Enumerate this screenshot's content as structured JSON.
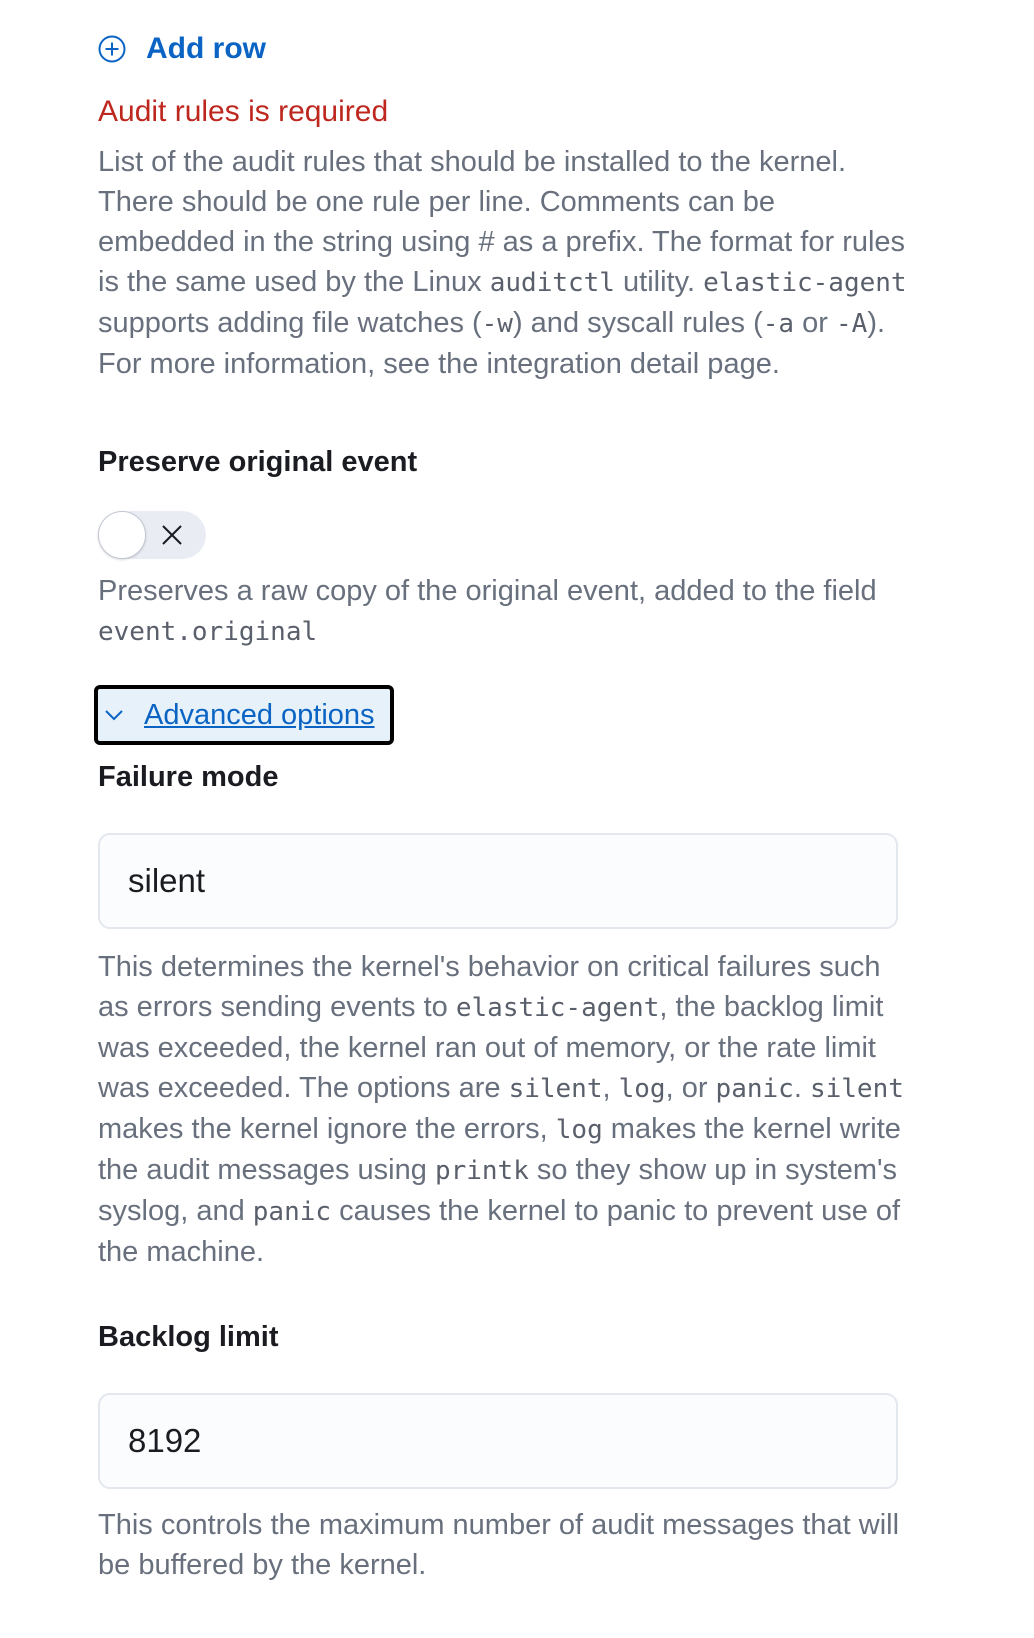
{
  "add_row": {
    "label": "Add row",
    "icon": "plus-circle-icon"
  },
  "audit_rules": {
    "error": "Audit rules is required",
    "help": {
      "t1": "List of the audit rules that should be installed to the kernel. There should be one rule per line. Comments can be embedded in the string using # as a prefix. The format for rules is the same used by the Linux ",
      "c1": "auditctl",
      "t2": " utility. ",
      "c2": "elastic-agent",
      "t3": " supports adding file watches (",
      "c3": "-w",
      "t4": ") and syscall rules (",
      "c4": "-a",
      "t5": " or ",
      "c5": "-A",
      "t6": "). For more information, see the integration detail page."
    }
  },
  "preserve_original": {
    "label": "Preserve original event",
    "toggle_on": false,
    "help_text": "Preserves a raw copy of the original event, added to the field ",
    "help_code": "event.original"
  },
  "advanced_options": {
    "label": "Advanced options",
    "icon": "chevron-down-icon"
  },
  "failure_mode": {
    "label": "Failure mode",
    "value": "silent",
    "help": {
      "t1": "This determines the kernel's behavior on critical failures such as errors sending events to ",
      "c1": "elastic-agent",
      "t2": ", the backlog limit was exceeded, the kernel ran out of memory, or the rate limit was exceeded. The options are ",
      "c2": "silent",
      "t3": ", ",
      "c3": "log",
      "t4": ", or ",
      "c4": "panic",
      "t5": ". ",
      "c5": "silent",
      "t6": " makes the kernel ignore the errors, ",
      "c6": "log",
      "t7": " makes the kernel write the audit messages using ",
      "c7": "printk",
      "t8": " so they show up in system's syslog, and ",
      "c8": "panic",
      "t9": " causes the kernel to panic to prevent use of the machine."
    }
  },
  "backlog_limit": {
    "label": "Backlog limit",
    "value": "8192",
    "help": "This controls the maximum number of audit messages that will be buffered by the kernel."
  },
  "colors": {
    "link": "#0b64c4",
    "error": "#bd271e",
    "help_text": "#69707d",
    "label": "#1a1c21"
  }
}
